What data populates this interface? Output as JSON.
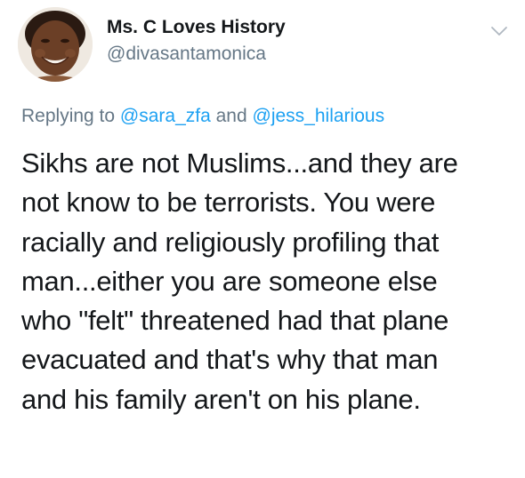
{
  "author": {
    "display_name": "Ms. C Loves History",
    "handle": "@divasantamonica",
    "avatar_icon": "user-avatar-photo"
  },
  "menu": {
    "icon": "chevron-down-icon",
    "color": "#b0b8c1"
  },
  "reply": {
    "prefix": "Replying to",
    "mention1": "@sara_zfa",
    "conjunction": "and",
    "mention2": "@jess_hilarious"
  },
  "tweet": {
    "lines": [
      "Sikhs are not Muslims...and they are",
      "not know to be terrorists. You were",
      "racially and religiously profiling that",
      "man...either you are someone else",
      "who \"felt\" threatened had that plane",
      "evacuated and that's why that man",
      "and his family aren't on his plane."
    ]
  },
  "colors": {
    "text": "#14171a",
    "secondary": "#657786",
    "link": "#1da1f2"
  }
}
